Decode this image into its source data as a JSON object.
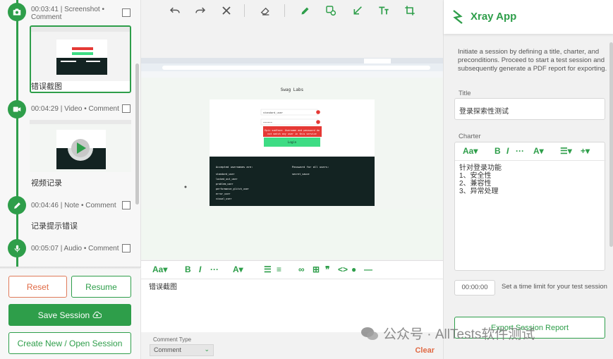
{
  "timeline": {
    "items": [
      {
        "meta": "00:03:41 | Screenshot •",
        "meta2": "Comment",
        "label": "错误截图",
        "icon": "camera-icon"
      },
      {
        "meta": "00:04:29 | Video • Comment",
        "label": "视频记录",
        "icon": "video-icon"
      },
      {
        "meta": "00:04:46 | Note • Comment",
        "label": "记录提示错误",
        "icon": "pencil-icon"
      },
      {
        "meta": "00:05:07 | Audio • Comment",
        "icon": "mic-icon"
      }
    ]
  },
  "buttons": {
    "reset": "Reset",
    "resume": "Resume",
    "save": "Save Session",
    "open": "Create New / Open Session"
  },
  "screenshot": {
    "page_title": "Swag Labs",
    "username_value": "standard_user",
    "password_value": "••••••",
    "error_text": "Epic sadface: Username and password do not match any user in this service",
    "login_label": "Login",
    "accepted_title": "Accepted usernames are:",
    "usernames": [
      "standard_user",
      "locked_out_user",
      "problem_user",
      "performance_glitch_user",
      "error_user",
      "visual_user"
    ],
    "password_title": "Password for all users:",
    "password": "secret_sauce"
  },
  "editor": {
    "text": "错误截图",
    "comment_type_label": "Comment Type",
    "comment_type_value": "Comment",
    "clear": "Clear"
  },
  "right": {
    "app_title": "Xray App",
    "description": "Initiate a session by defining a title, charter, and preconditions. Proceed to start a test session and subsequently generate a PDF report for exporting.",
    "title_label": "Title",
    "title_value": "登录探索性测试",
    "charter_label": "Charter",
    "charter_lines": [
      "针对登录功能",
      "1、安全性",
      "2、兼容性",
      "3、异常处理"
    ],
    "time_value": "00:00:00",
    "time_hint": "Set a time limit for your test session",
    "export": "Export Session Report"
  },
  "watermark": "公众号 · AllTests软件测试",
  "colors": {
    "accent": "#2e9e4a",
    "danger": "#e06a45"
  }
}
